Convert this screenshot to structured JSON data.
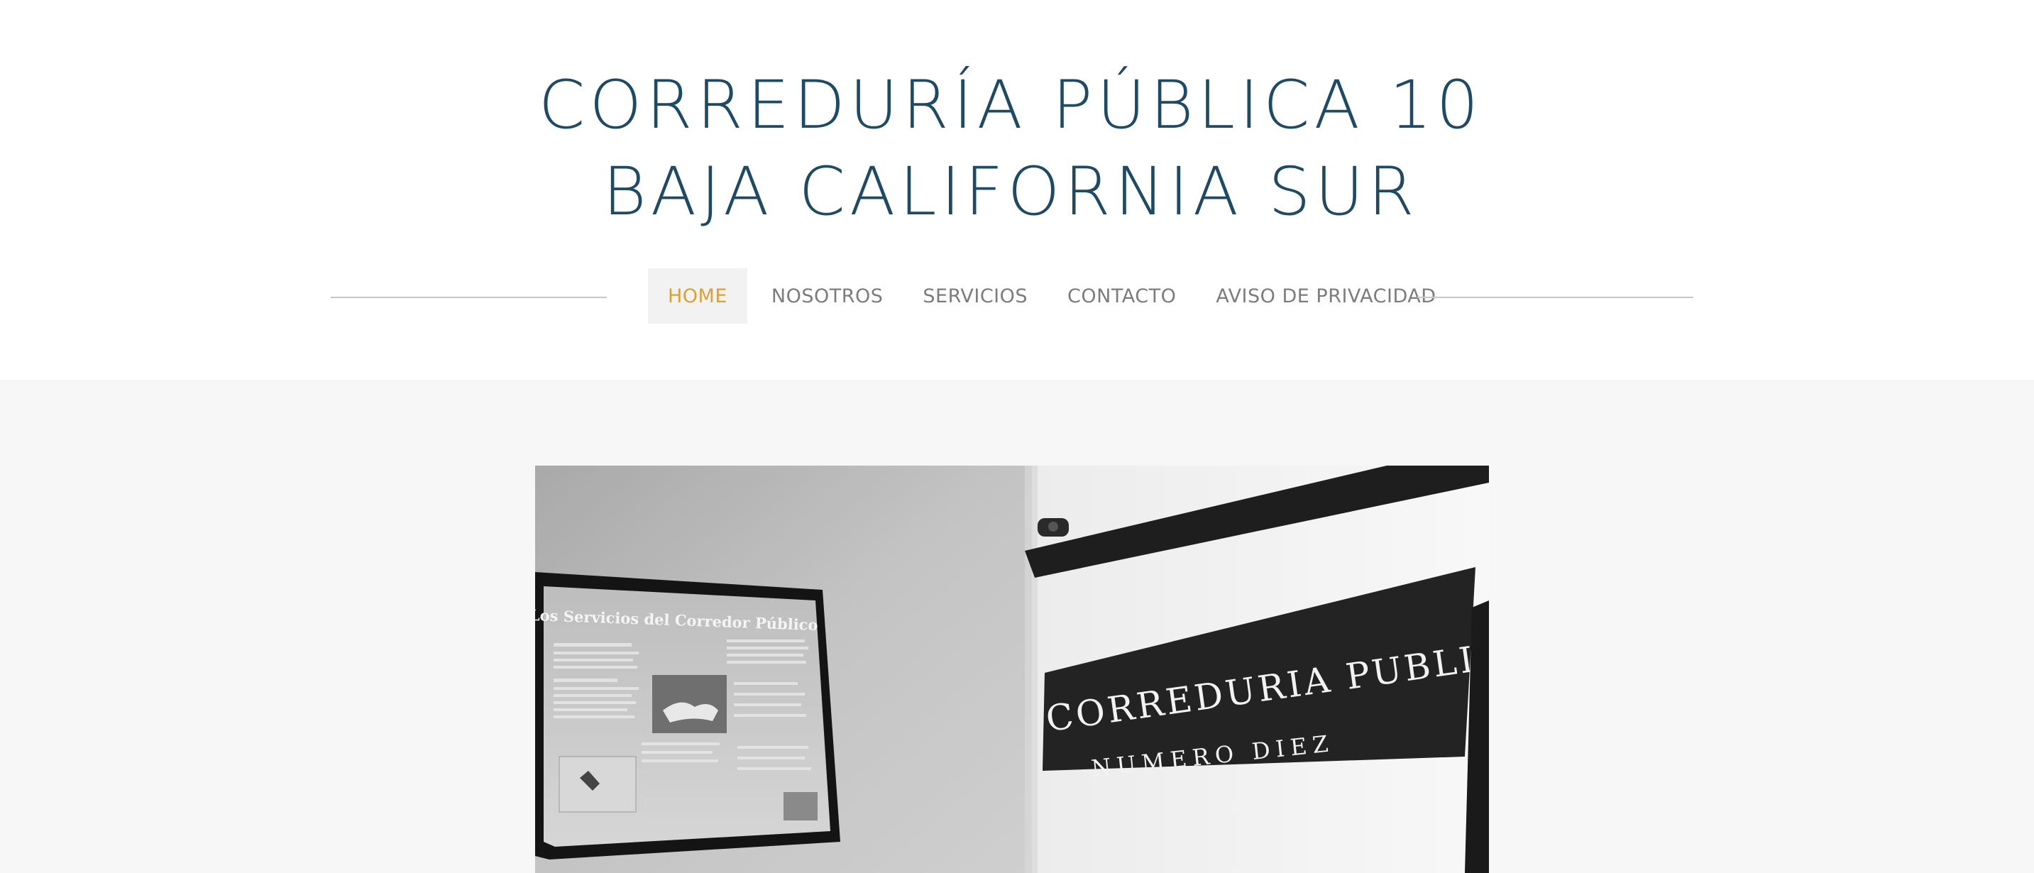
{
  "header": {
    "title_line1": "CORREDURÍA PÚBLICA 10",
    "title_line2": "BAJA CALIFORNIA SUR"
  },
  "nav": {
    "items": [
      {
        "label": "HOME",
        "active": true
      },
      {
        "label": "NOSOTROS",
        "active": false
      },
      {
        "label": "SERVICIOS",
        "active": false
      },
      {
        "label": "CONTACTO",
        "active": false
      },
      {
        "label": "AVISO DE PRIVACIDAD",
        "active": false
      }
    ]
  },
  "hero": {
    "poster_title": "Los Servicios del Corredor Público",
    "sign_line1": "CORREDURIA PUBLICA",
    "sign_line2": "NUMERO DIEZ"
  },
  "colors": {
    "title": "#1f4a63",
    "nav_active": "#d9a13a",
    "nav_text": "#7c7c7c",
    "nav_active_bg": "#f2f2f2",
    "content_bg": "#f7f7f7"
  }
}
